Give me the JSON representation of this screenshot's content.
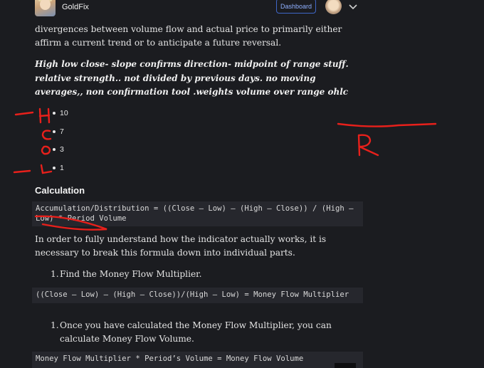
{
  "header": {
    "brand": "GoldFix",
    "dashboard_label": "Dashboard"
  },
  "paragraphs": {
    "intro": "divergences between volume flow and actual price to primarily either affirm a current trend or to anticipate a future reversal.",
    "note": "High low close- slope confirms direction- midpoint of range stuff. relative strength.. not divided by previous days. no moving averages,, non confirmation tool .weights volume over range ohlc",
    "explain": "In order to fully understand how the indicator actually works, it is necessary to break this formula down into individual parts."
  },
  "bullets": [
    "10",
    "7",
    "3",
    "1"
  ],
  "calculation": {
    "heading": "Calculation",
    "formula": "Accumulation/Distribution = ((Close – Low) – (High – Close)) / (High – Low) * Period Volume",
    "step1_num": "1.",
    "step1": "Find the Money Flow Multiplier.",
    "formula2": "((Close – Low) – (High – Close))/(High – Low) = Money Flow Multiplier",
    "step2_num": "1.",
    "step2": "Once you have calculated the Money Flow Multiplier, you can calculate Money Flow Volume.",
    "formula3": "Money Flow Multiplier * Period’s Volume = Money Flow Volume"
  },
  "annotations": {
    "color": "#e8201b",
    "letters": [
      "H",
      "C",
      "O",
      "L",
      "R"
    ]
  },
  "icons": {
    "chevron": "chevron-down-icon"
  }
}
